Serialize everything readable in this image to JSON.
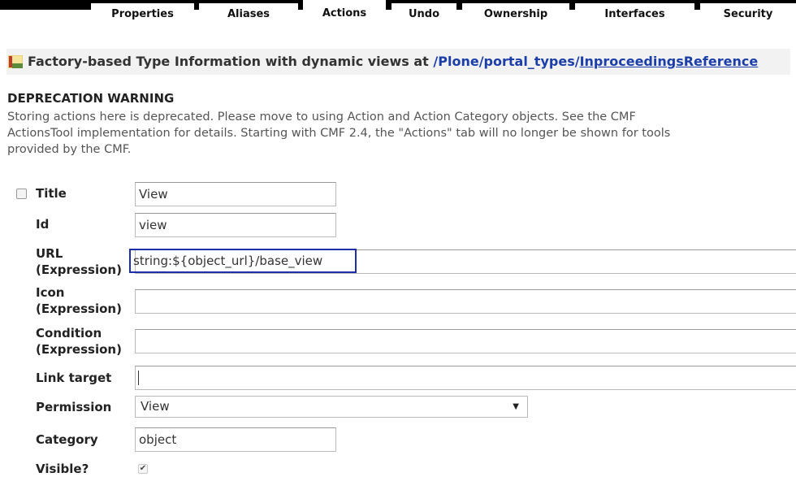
{
  "tabs": [
    {
      "label": "Properties"
    },
    {
      "label": "Aliases"
    },
    {
      "label": "Actions"
    },
    {
      "label": "Undo"
    },
    {
      "label": "Ownership"
    },
    {
      "label": "Interfaces"
    },
    {
      "label": "Security"
    }
  ],
  "header": {
    "prefix": "Factory-based Type Information with dynamic views at ",
    "path_plain": "/Plone/portal_types/",
    "path_link": "InproceedingsReference"
  },
  "deprecation": {
    "title": "DEPRECATION WARNING",
    "line1": "Storing actions here is deprecated. Please move to using Action and Action Category objects. See the CMF",
    "line2": "ActionsTool implementation for details. Starting with CMF 2.4, the \"Actions\" tab will no longer be shown for tools",
    "line3": "provided by the CMF."
  },
  "form": {
    "title": {
      "label": "Title",
      "value": "View"
    },
    "id": {
      "label": "Id",
      "value": "view"
    },
    "url": {
      "label1": "URL",
      "label2": "(Expression)",
      "value": "string:${object_url}/base_view"
    },
    "icon": {
      "label1": "Icon",
      "label2": "(Expression)",
      "value": ""
    },
    "condition": {
      "label1": "Condition",
      "label2": "(Expression)",
      "value": ""
    },
    "link_target": {
      "label": "Link target",
      "value": ""
    },
    "permission": {
      "label": "Permission",
      "value": "View"
    },
    "category": {
      "label": "Category",
      "value": "object"
    },
    "visible": {
      "label": "Visible?",
      "checked": true
    }
  }
}
